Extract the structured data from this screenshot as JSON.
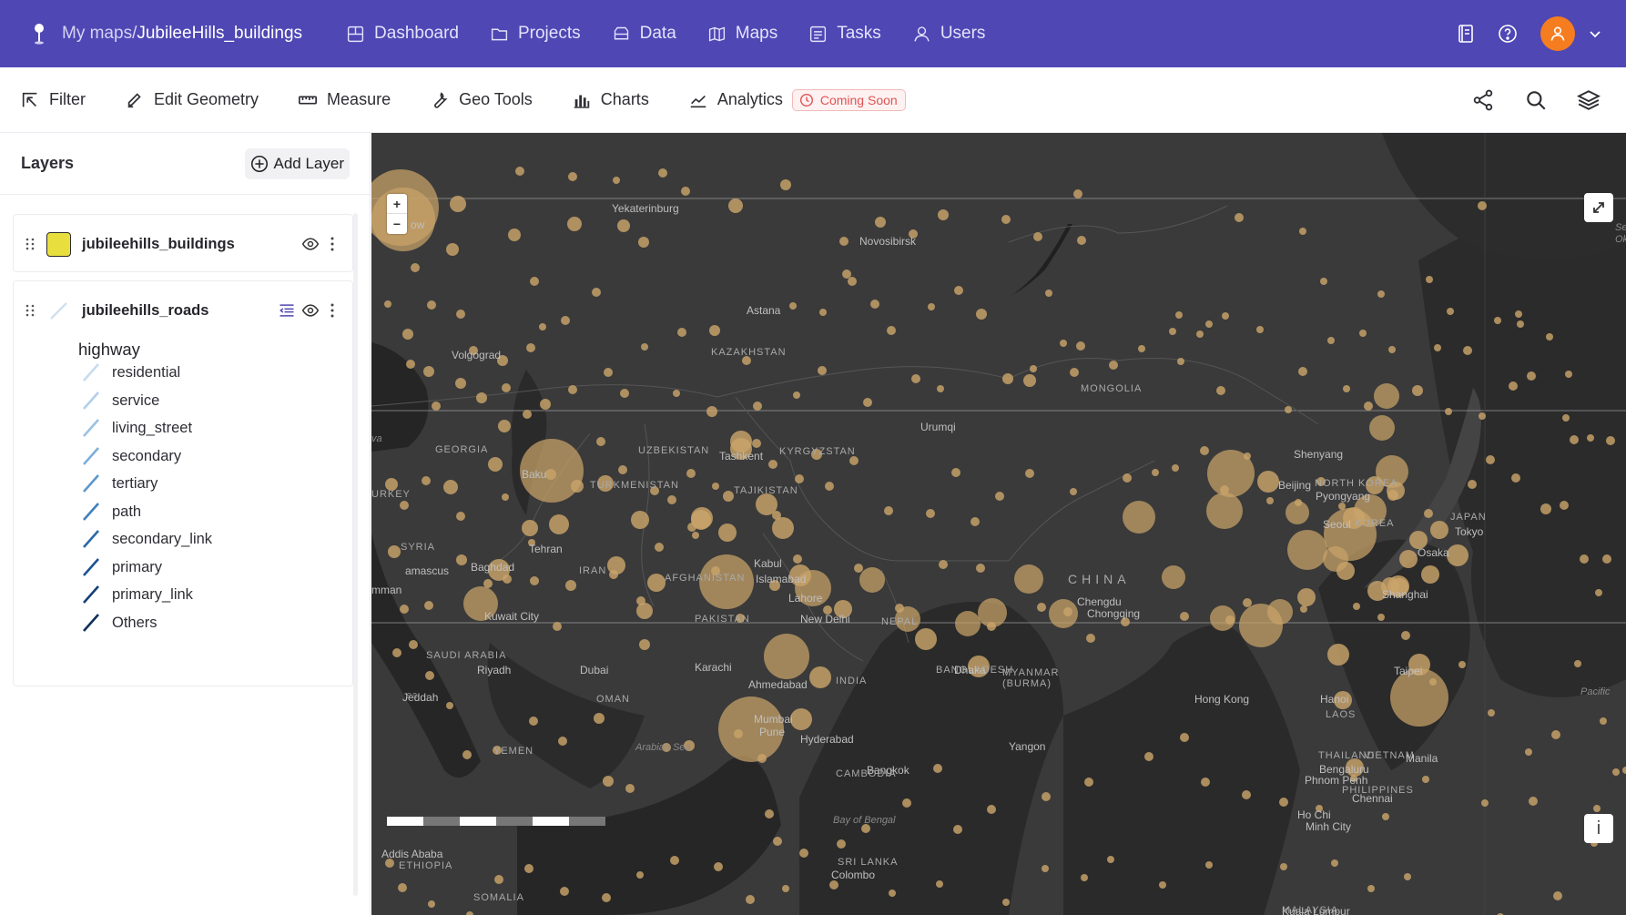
{
  "topbar": {
    "crumb_prefix": "My maps/",
    "crumb_current": "JubileeHills_buildings",
    "nav": [
      {
        "label": "Dashboard",
        "icon": "dashboard-icon"
      },
      {
        "label": "Projects",
        "icon": "folder-icon"
      },
      {
        "label": "Data",
        "icon": "database-icon"
      },
      {
        "label": "Maps",
        "icon": "map-icon"
      },
      {
        "label": "Tasks",
        "icon": "tasks-icon"
      },
      {
        "label": "Users",
        "icon": "user-icon"
      }
    ],
    "avatar_color": "#f57c1f",
    "bar_color": "#4f47b4"
  },
  "toolbar": {
    "filter": "Filter",
    "edit_geometry": "Edit Geometry",
    "measure": "Measure",
    "geo_tools": "Geo Tools",
    "charts": "Charts",
    "analytics": "Analytics",
    "coming_soon": "Coming Soon"
  },
  "panel": {
    "title": "Layers",
    "add_layer": "Add Layer",
    "layers": [
      {
        "name": "jubileehills_buildings",
        "swatch": "#e8df3f"
      },
      {
        "name": "jubileehills_roads"
      }
    ],
    "legend": {
      "title": "highway",
      "items": [
        {
          "label": "residential",
          "color": "#c7dcef"
        },
        {
          "label": "service",
          "color": "#b2cfea"
        },
        {
          "label": "living_street",
          "color": "#9cc1e2"
        },
        {
          "label": "secondary",
          "color": "#7eaed8"
        },
        {
          "label": "tertiary",
          "color": "#5c97cb"
        },
        {
          "label": "path",
          "color": "#3f80bd"
        },
        {
          "label": "secondary_link",
          "color": "#2a69a8"
        },
        {
          "label": "primary",
          "color": "#1d5291"
        },
        {
          "label": "primary_link",
          "color": "#173f76"
        },
        {
          "label": "Others",
          "color": "#10305b"
        }
      ]
    }
  },
  "map": {
    "zoom_in": "+",
    "zoom_out": "−",
    "info": "i",
    "background": "#373737",
    "marker_color": "#c9a46a",
    "labels": [
      {
        "text": "Yekaterinburg",
        "kind": "city"
      },
      {
        "text": "Novosibirsk",
        "kind": "city"
      },
      {
        "text": "Astana",
        "kind": "city"
      },
      {
        "text": "Volgograd",
        "kind": "city"
      },
      {
        "text": "KAZAKHSTAN",
        "kind": "country"
      },
      {
        "text": "MONGOLIA",
        "kind": "country"
      },
      {
        "text": "Urumqi",
        "kind": "city"
      },
      {
        "text": "GEORGIA",
        "kind": "country"
      },
      {
        "text": "UZBEKISTAN",
        "kind": "country"
      },
      {
        "text": "Tashkent",
        "kind": "city"
      },
      {
        "text": "KYRGYZSTAN",
        "kind": "country"
      },
      {
        "text": "Baku",
        "kind": "city"
      },
      {
        "text": "TURKMENISTAN",
        "kind": "country"
      },
      {
        "text": "TAJIKISTAN",
        "kind": "country"
      },
      {
        "text": "Shenyang",
        "kind": "city"
      },
      {
        "text": "Beijing",
        "kind": "city"
      },
      {
        "text": "NORTH KOREA",
        "kind": "country"
      },
      {
        "text": "Pyongyang",
        "kind": "city"
      },
      {
        "text": "Seoul",
        "kind": "city"
      },
      {
        "text": "KOREA",
        "kind": "country"
      },
      {
        "text": "JAPAN",
        "kind": "country"
      },
      {
        "text": "Tokyo",
        "kind": "city"
      },
      {
        "text": "Osaka",
        "kind": "city"
      },
      {
        "text": "URKEY",
        "kind": "country"
      },
      {
        "text": "SYRIA",
        "kind": "country"
      },
      {
        "text": "Tehran",
        "kind": "city"
      },
      {
        "text": "amascus",
        "kind": "city"
      },
      {
        "text": "Baghdad",
        "kind": "city"
      },
      {
        "text": "IRAN",
        "kind": "country"
      },
      {
        "text": "AFGHANISTAN",
        "kind": "country"
      },
      {
        "text": "Kabul",
        "kind": "city"
      },
      {
        "text": "Islamabad",
        "kind": "city"
      },
      {
        "text": "CHINA",
        "kind": "big"
      },
      {
        "text": "mman",
        "kind": "city"
      },
      {
        "text": "Lahore",
        "kind": "city"
      },
      {
        "text": "Chengdu",
        "kind": "city"
      },
      {
        "text": "Chongqing",
        "kind": "city"
      },
      {
        "text": "Shanghai",
        "kind": "city"
      },
      {
        "text": "Kuwait City",
        "kind": "city"
      },
      {
        "text": "PAKISTAN",
        "kind": "country"
      },
      {
        "text": "New Delhi",
        "kind": "city"
      },
      {
        "text": "NEPAL",
        "kind": "country"
      },
      {
        "text": "SAUDI ARABIA",
        "kind": "country"
      },
      {
        "text": "Riyadh",
        "kind": "city"
      },
      {
        "text": "Dubai",
        "kind": "city"
      },
      {
        "text": "Karachi",
        "kind": "city"
      },
      {
        "text": "Taipei",
        "kind": "city"
      },
      {
        "text": "BANGLADESH",
        "kind": "country"
      },
      {
        "text": "Dhaka",
        "kind": "city"
      },
      {
        "text": "MYANMAR",
        "kind": "country"
      },
      {
        "text": "(BURMA)",
        "kind": "country"
      },
      {
        "text": "INDIA",
        "kind": "country"
      },
      {
        "text": "Ahmedabad",
        "kind": "city"
      },
      {
        "text": "Hong Kong",
        "kind": "city"
      },
      {
        "text": "Jeddah",
        "kind": "city"
      },
      {
        "text": "OMAN",
        "kind": "country"
      },
      {
        "text": "Hanoi",
        "kind": "city"
      },
      {
        "text": "Pacific",
        "kind": "sea"
      },
      {
        "text": "LAOS",
        "kind": "country"
      },
      {
        "text": "Mumbai",
        "kind": "city"
      },
      {
        "text": "Pune",
        "kind": "city"
      },
      {
        "text": "Hyderabad",
        "kind": "city"
      },
      {
        "text": "Yangon",
        "kind": "city"
      },
      {
        "text": "YEMEN",
        "kind": "country"
      },
      {
        "text": "Arabian Sea",
        "kind": "sea"
      },
      {
        "text": "THAILAND",
        "kind": "country"
      },
      {
        "text": "VIETNAM",
        "kind": "country"
      },
      {
        "text": "Manila",
        "kind": "city"
      },
      {
        "text": "Bay of Bengal",
        "kind": "sea"
      },
      {
        "text": "Bangkok",
        "kind": "city"
      },
      {
        "text": "Bengaluru",
        "kind": "city"
      },
      {
        "text": "Chennai",
        "kind": "city"
      },
      {
        "text": "CAMBODIA",
        "kind": "country"
      },
      {
        "text": "Phnom Penh",
        "kind": "city"
      },
      {
        "text": "PHILIPPINES",
        "kind": "country"
      },
      {
        "text": "Ho Chi",
        "kind": "city"
      },
      {
        "text": "Minh City",
        "kind": "city"
      },
      {
        "text": "Addis Ababa",
        "kind": "city"
      },
      {
        "text": "ETHIOPIA",
        "kind": "country"
      },
      {
        "text": "SRI LANKA",
        "kind": "country"
      },
      {
        "text": "Colombo",
        "kind": "city"
      },
      {
        "text": "SOMALIA",
        "kind": "country"
      },
      {
        "text": "MALAYSIA",
        "kind": "country"
      },
      {
        "text": "Kuala Lumpur",
        "kind": "city"
      },
      {
        "text": "Sea of",
        "kind": "sea"
      },
      {
        "text": "Okhotsk",
        "kind": "sea"
      },
      {
        "text": "ow",
        "kind": "city"
      },
      {
        "text": "ea",
        "kind": "sea"
      },
      {
        "text": "va",
        "kind": "sea"
      }
    ]
  }
}
